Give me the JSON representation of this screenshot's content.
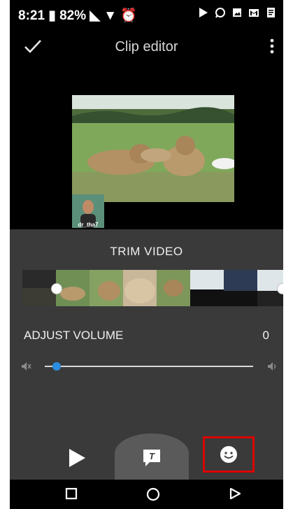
{
  "status_bar": {
    "time": "8:21",
    "battery": "82%",
    "icons": [
      "battery-icon",
      "signal-icon",
      "wifi-icon",
      "alarm-icon",
      "play-store-icon",
      "whatsapp-icon",
      "gallery-icon",
      "gmail-icon",
      "notes-icon"
    ]
  },
  "header": {
    "title": "Clip editor",
    "done_icon": "check-icon",
    "menu_icon": "more-vert-icon"
  },
  "preview": {
    "pip_label": "dr_tha7"
  },
  "trim": {
    "title": "TRIM VIDEO"
  },
  "volume": {
    "title": "ADJUST VOLUME",
    "value": "0",
    "mute_icon": "mute-icon",
    "max_icon": "volume-icon"
  },
  "toolbar": {
    "play_icon": "play-icon",
    "text_icon": "text-overlay-icon",
    "text_glyph": "T",
    "sticker_icon": "sticker-icon"
  },
  "nav": {
    "recents": "recents-icon",
    "home": "home-icon",
    "back": "back-icon"
  },
  "colors": {
    "panel": "#3a3a3a",
    "accent": "#2b8ee0",
    "highlight": "#d00000"
  }
}
